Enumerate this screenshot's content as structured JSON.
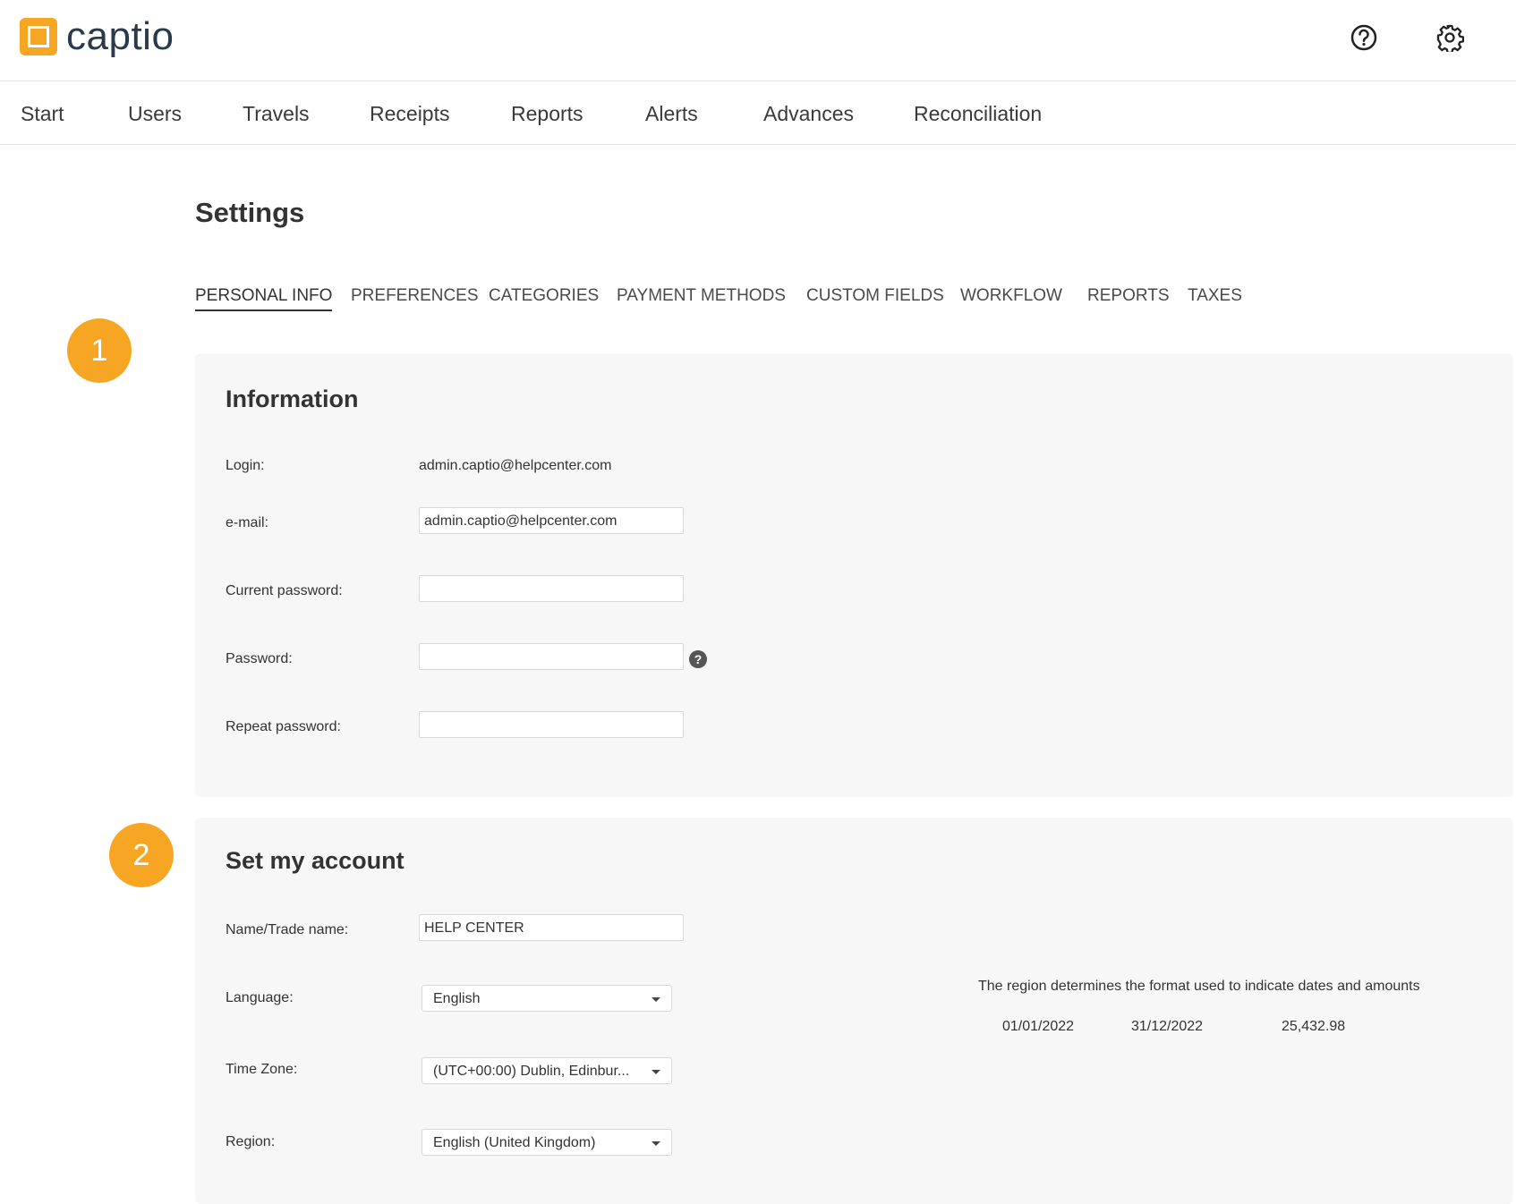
{
  "brand": {
    "name": "captio",
    "color": "#f6a623"
  },
  "header": {
    "help_icon": "help-circle-icon",
    "settings_icon": "gear-icon"
  },
  "nav": {
    "items": [
      {
        "label": "Start"
      },
      {
        "label": "Users"
      },
      {
        "label": "Travels"
      },
      {
        "label": "Receipts"
      },
      {
        "label": "Reports"
      },
      {
        "label": "Alerts"
      },
      {
        "label": "Advances"
      },
      {
        "label": "Reconciliation"
      }
    ]
  },
  "page": {
    "title": "Settings"
  },
  "tabs": {
    "items": [
      {
        "label": "PERSONAL INFO",
        "active": true
      },
      {
        "label": "PREFERENCES"
      },
      {
        "label": "CATEGORIES"
      },
      {
        "label": "PAYMENT METHODS"
      },
      {
        "label": "CUSTOM FIELDS"
      },
      {
        "label": "WORKFLOW"
      },
      {
        "label": "REPORTS"
      },
      {
        "label": "TAXES"
      }
    ]
  },
  "badges": {
    "first": "1",
    "second": "2"
  },
  "information": {
    "title": "Information",
    "login_label": "Login:",
    "login_value": "admin.captio@helpcenter.com",
    "email_label": "e-mail:",
    "email_value": "admin.captio@helpcenter.com",
    "current_password_label": "Current password:",
    "password_label": "Password:",
    "password_help": "?",
    "repeat_password_label": "Repeat password:"
  },
  "account": {
    "title": "Set my account",
    "name_label": "Name/Trade name:",
    "name_value": "HELP CENTER",
    "language_label": "Language:",
    "language_value": "English",
    "timezone_label": "Time Zone:",
    "timezone_value": "(UTC+00:00) Dublin, Edinbur...",
    "region_label": "Region:",
    "region_value": "English (United Kingdom)",
    "region_note": "The region determines the format used to indicate dates and amounts",
    "format_date_start": "01/01/2022",
    "format_date_end": "31/12/2022",
    "format_amount": "25,432.98"
  }
}
